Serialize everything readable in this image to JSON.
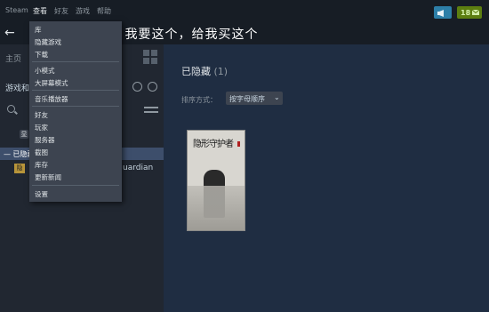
{
  "menubar": {
    "items": [
      "Steam",
      "查看",
      "好友",
      "游戏",
      "帮助"
    ],
    "notification_count": "18"
  },
  "nav": {
    "title_visible": "区    我要这个，给我买这个"
  },
  "sidebar": {
    "home_label": "主页",
    "games_label": "游戏和",
    "small_badge": "显",
    "hidden_header": "— 已隐藏",
    "game_name_tail": "uardian"
  },
  "main": {
    "section_title": "已隐藏",
    "section_count": "(1)",
    "sort_label": "排序方式：",
    "sort_value": "按字母顺序",
    "cover_title": "隐形守护者"
  },
  "view_menu": {
    "groups": [
      [
        "库",
        "隐藏游戏",
        "下载"
      ],
      [
        "小模式",
        "大屏幕模式"
      ],
      [
        "音乐播放器"
      ],
      [
        "好友",
        "玩家",
        "服务器",
        "截图",
        "库存",
        "更新新闻"
      ],
      [
        "设置"
      ]
    ]
  },
  "colors": {
    "background": "#1b2838",
    "menu_bg": "#3d4450",
    "hidden_header": "#3d4e6b",
    "notification_green": "#5c7e10",
    "chat_blue": "#2d7fa8"
  }
}
